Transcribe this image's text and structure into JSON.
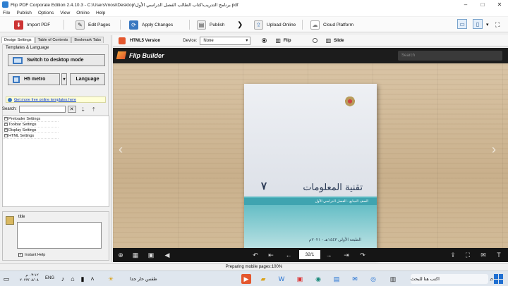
{
  "window": {
    "title": "Flip PDF Corporate Edition 2.4.10.3 - C:\\Users\\mosi\\Desktop\\برنامج التدريب\\كتاب الطالب الفصل الدراسي الأول.pdf",
    "min": "–",
    "max": "□",
    "close": "✕"
  },
  "menu": [
    "File",
    "Publish",
    "Options",
    "View",
    "Online",
    "Help"
  ],
  "toolbar": {
    "import": "Import PDF",
    "edit": "Edit Pages",
    "apply": "Apply Changes",
    "publish": "Publish",
    "upload": "Upload Online",
    "cloud": "Cloud Platform"
  },
  "left": {
    "tabs": [
      "Design Settings",
      "Table of Contents",
      "Bookmark Tabs"
    ],
    "group_label": "Templates & Language",
    "desktop_mode": "Switch to desktop mode",
    "template": "H5 metro",
    "language": "Language",
    "promo": "Get more free online templates here",
    "search_label": "Search:",
    "search_value": "",
    "tree": [
      "Preloader Settings",
      "Toolbar Settings",
      "Display Settings",
      "HTML Settings"
    ],
    "desc_title": "title",
    "instant_help": "Instant Help"
  },
  "verbar": {
    "version": "HTML5 Version",
    "device_label": "Device:",
    "device_value": "None",
    "flip": "Flip",
    "slide": "Slide"
  },
  "preview": {
    "logo": "Flip Builder",
    "search_placeholder": "Search",
    "book_title": "تقنية المعلومات",
    "book_number": "٧",
    "book_subtitle": "الصف السابع - الفصل الدراسي الأول",
    "book_edition": "الطبعة الأولى ١٤٤٣هـ - ٢٠٢١م",
    "page": "32/1"
  },
  "status": "Preparing mobile pages:100%",
  "taskbar": {
    "search": "اكتب هنا للبحث",
    "weather": "طقس حار جدا",
    "lang": "ENG",
    "time": "٠٣:١٢ م",
    "date": "٢٠٢٣/٠٨/٠٨"
  }
}
